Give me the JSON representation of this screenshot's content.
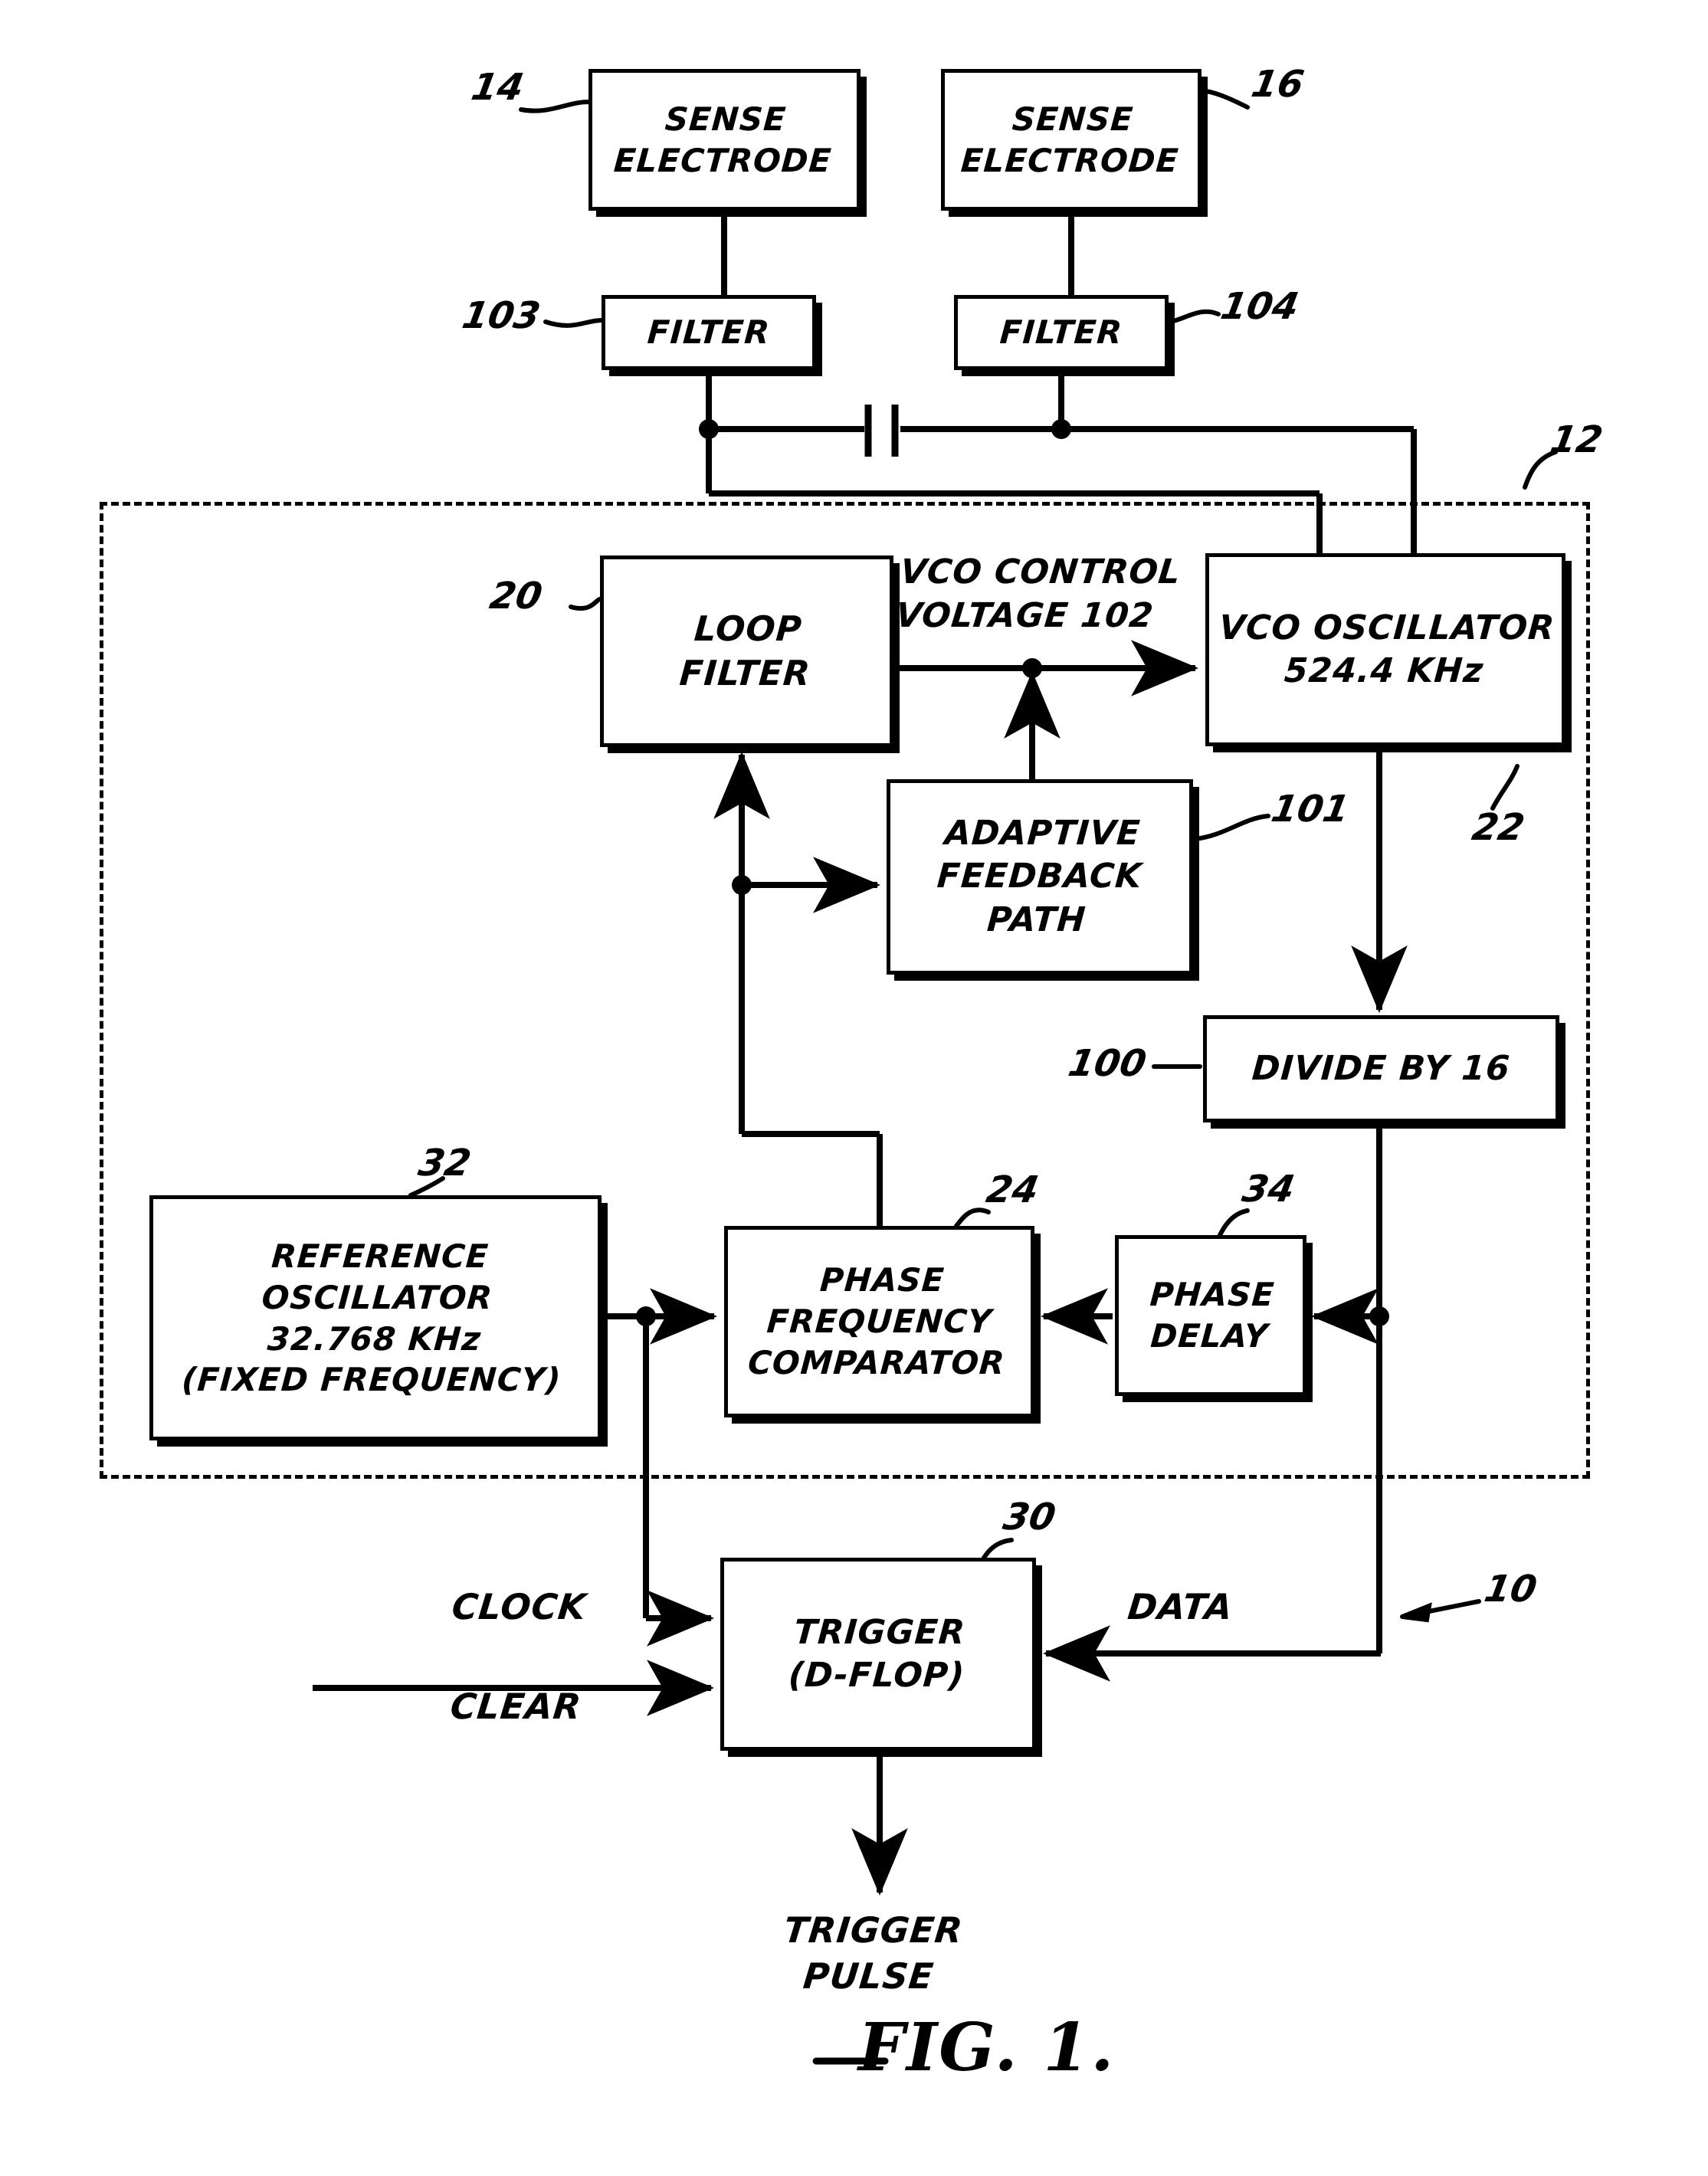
{
  "figure": {
    "caption": "FIG. 1.",
    "system_ref": "10",
    "enclosure_ref": "12"
  },
  "blocks": [
    {
      "id": "sense_electrode_left",
      "label": "SENSE\nELECTRODE",
      "ref": "14"
    },
    {
      "id": "sense_electrode_right",
      "label": "SENSE\nELECTRODE",
      "ref": "16"
    },
    {
      "id": "filter_left",
      "label": "FILTER",
      "ref": "103"
    },
    {
      "id": "filter_right",
      "label": "FILTER",
      "ref": "104"
    },
    {
      "id": "loop_filter",
      "label": "LOOP\nFILTER",
      "ref": "20"
    },
    {
      "id": "vco_oscillator",
      "label": "VCO OSCILLATOR\n524.4 KHz",
      "ref": "22"
    },
    {
      "id": "adaptive_feedback",
      "label": "ADAPTIVE\nFEEDBACK\nPATH",
      "ref": "101"
    },
    {
      "id": "divide_by_16",
      "label": "DIVIDE BY 16",
      "ref": "100"
    },
    {
      "id": "reference_oscillator",
      "label": "REFERENCE\nOSCILLATOR\n32.768 KHz\n(FIXED FREQUENCY)",
      "ref": "32"
    },
    {
      "id": "phase_freq_comparator",
      "label": "PHASE\nFREQUENCY\nCOMPARATOR",
      "ref": "24"
    },
    {
      "id": "phase_delay",
      "label": "PHASE\nDELAY",
      "ref": "34"
    },
    {
      "id": "trigger_dflop",
      "label": "TRIGGER\n(D-FLOP)",
      "ref": "30"
    }
  ],
  "signal_labels": {
    "vco_control_voltage": "VCO CONTROL\nVOLTAGE 102",
    "clock": "CLOCK",
    "clear": "CLEAR",
    "data": "DATA",
    "trigger_pulse": "TRIGGER\nPULSE"
  },
  "colors": {
    "ink": "#000000",
    "paper": "#ffffff"
  }
}
